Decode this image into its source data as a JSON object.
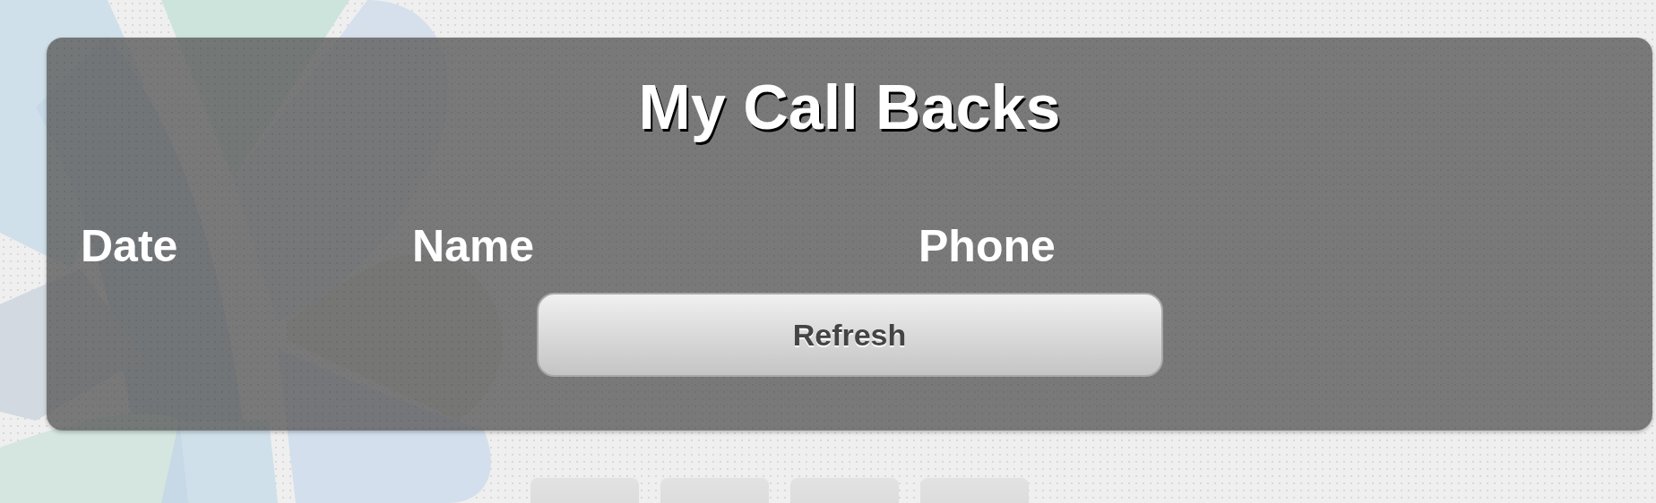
{
  "panel": {
    "title": "My Call Backs",
    "columns": [
      {
        "label": "Date"
      },
      {
        "label": "Name"
      },
      {
        "label": "Phone"
      }
    ],
    "refresh_button": {
      "label": "Refresh"
    }
  },
  "bottom_bar": {
    "buttons": [
      {
        "kind": "blank"
      },
      {
        "kind": "blank"
      },
      {
        "kind": "blank"
      },
      {
        "kind": "blank"
      }
    ]
  }
}
